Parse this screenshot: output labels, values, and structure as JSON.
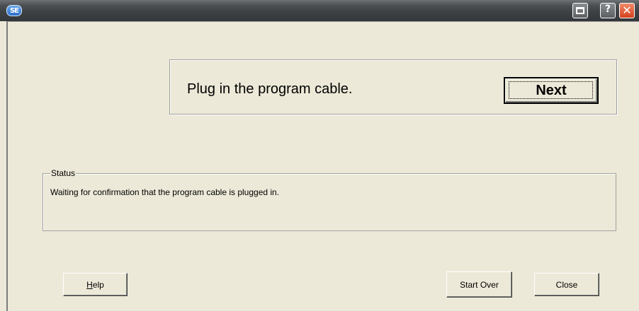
{
  "window": {
    "icon_label": "SE",
    "help_glyph": "?",
    "close_glyph": "✕"
  },
  "instruction": {
    "text": "Plug in the program cable.",
    "next_label": "Next"
  },
  "status": {
    "legend": "Status",
    "message": "Waiting for confirmation that the program cable is plugged in."
  },
  "buttons": {
    "help_mnemonic": "H",
    "help_rest": "elp",
    "start_over_label": "Start Over",
    "close_label": "Close"
  }
}
